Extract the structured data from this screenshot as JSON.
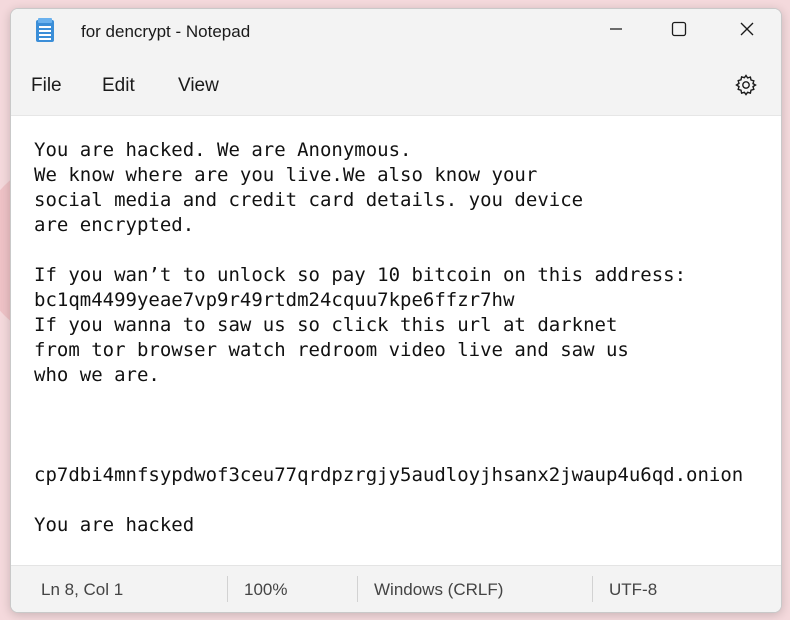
{
  "window": {
    "title": "for dencrypt - Notepad"
  },
  "menu": {
    "file": "File",
    "edit": "Edit",
    "view": "View"
  },
  "document": {
    "lines": [
      "You are hacked. We are Anonymous.",
      "We know where are you live.We also know your",
      "social media and credit card details. you device",
      "are encrypted.",
      "",
      "If you wan’t to unlock so pay 10 bitcoin on this address:",
      "bc1qm4499yeae7vp9r49rtdm24cquu7kpe6ffzr7hw",
      "If you wanna to saw us so click this url at darknet",
      "from tor browser watch redroom video live and saw us",
      "who we are.",
      "",
      "",
      "",
      "cp7dbi4mnfsypdwof3ceu77qrdpzrgjy5audloyjhsanx2jwaup4u6qd.onion",
      "",
      "You are hacked"
    ]
  },
  "status": {
    "position": "Ln 8, Col 1",
    "zoom": "100%",
    "line_ending": "Windows (CRLF)",
    "encoding": "UTF-8"
  },
  "icons": {
    "app": "notepad-icon",
    "minimize": "minimize-icon",
    "maximize": "maximize-icon",
    "close": "close-icon",
    "settings": "gear-icon"
  }
}
